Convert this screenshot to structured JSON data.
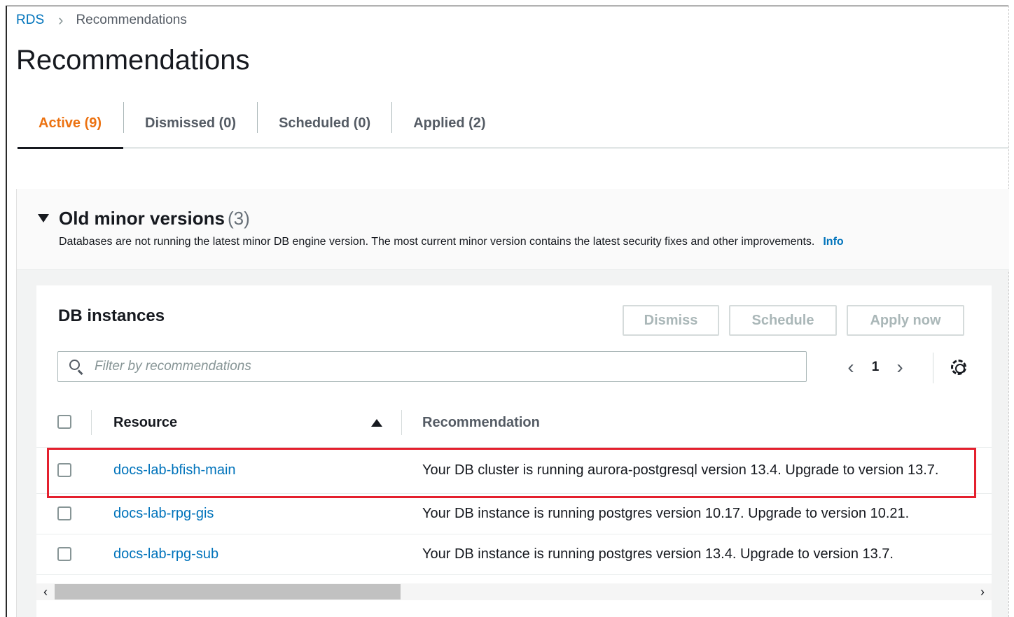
{
  "breadcrumb": {
    "root": "RDS",
    "current": "Recommendations"
  },
  "page_title": "Recommendations",
  "tabs": [
    {
      "label": "Active (9)",
      "active": true
    },
    {
      "label": "Dismissed (0)",
      "active": false
    },
    {
      "label": "Scheduled (0)",
      "active": false
    },
    {
      "label": "Applied (2)",
      "active": false
    }
  ],
  "section": {
    "title": "Old minor versions",
    "count": "(3)",
    "description": "Databases are not running the latest minor DB engine version. The most current minor version contains the latest security fixes and other improvements.",
    "info_link": "Info"
  },
  "card": {
    "title": "DB instances",
    "buttons": {
      "dismiss": "Dismiss",
      "schedule": "Schedule",
      "apply_now": "Apply now"
    },
    "search": {
      "placeholder": "Filter by recommendations",
      "value": ""
    },
    "pager": {
      "current_page": "1"
    }
  },
  "table": {
    "headers": {
      "resource": "Resource",
      "recommendation": "Recommendation"
    },
    "sort": {
      "column": "Resource",
      "direction": "ascending"
    },
    "rows": [
      {
        "resource": "docs-lab-bfish-main",
        "recommendation": "Your DB cluster is running aurora-postgresql version 13.4. Upgrade to version 13.7.",
        "highlighted": true
      },
      {
        "resource": "docs-lab-rpg-gis",
        "recommendation": "Your DB instance is running postgres version 10.17. Upgrade to version 10.21.",
        "highlighted": false
      },
      {
        "resource": "docs-lab-rpg-sub",
        "recommendation": "Your DB instance is running postgres version 13.4. Upgrade to version 13.7.",
        "highlighted": false
      }
    ]
  },
  "icons": {
    "separator": "chevron-right-icon",
    "section_toggle": "caret-down-icon",
    "search": "search-icon",
    "pager_prev": "chevron-left-icon",
    "pager_next": "chevron-right-icon",
    "preferences": "gear-icon",
    "sort": "sort-ascending-icon"
  },
  "colors": {
    "link": "#0073bb",
    "active_tab": "#ec7211",
    "highlight_border": "#e4202e",
    "disabled_button_text": "#aab7b8"
  }
}
